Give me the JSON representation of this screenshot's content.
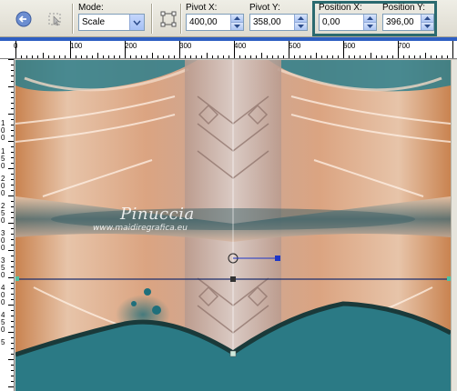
{
  "toolbar": {
    "mode": {
      "label": "Mode:",
      "value": "Scale"
    },
    "pivot_x": {
      "label": "Pivot X:",
      "value": "400,00"
    },
    "pivot_y": {
      "label": "Pivot Y:",
      "value": "358,00"
    },
    "position_x": {
      "label": "Position X:",
      "value": "0,00"
    },
    "position_y": {
      "label": "Position Y:",
      "value": "396,00"
    },
    "highlight_color": "#2b6a6f"
  },
  "ruler": {
    "horizontal": [
      "0",
      "100",
      "200",
      "300",
      "400",
      "500",
      "600",
      "700"
    ],
    "vertical": [
      "1",
      "0",
      "0",
      "1",
      "5",
      "0",
      "2",
      "0",
      "0",
      "2",
      "5",
      "0",
      "3",
      "0",
      "0",
      "3",
      "5",
      "0",
      "4",
      "0",
      "0",
      "4",
      "5",
      "0",
      "5"
    ]
  },
  "watermark": {
    "name": "Pinuccia",
    "url": "www.maidiregrafica.eu"
  },
  "colors": {
    "accent": "#2e5fc2",
    "teal": "#2b7a85",
    "copper": "#c8723a"
  }
}
